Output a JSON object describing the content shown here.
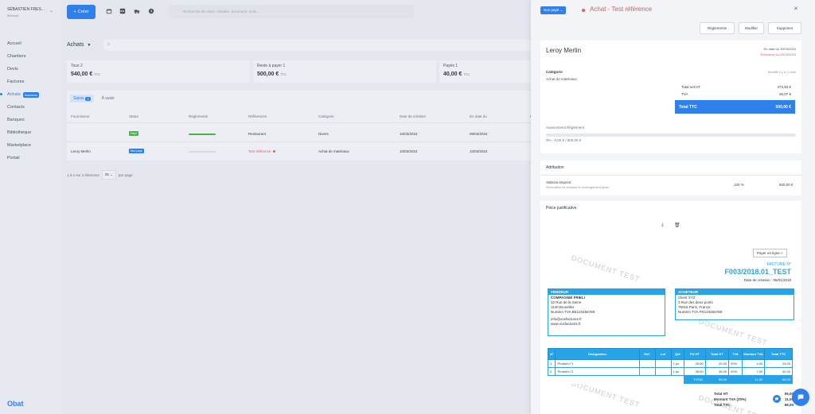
{
  "sidebar": {
    "user_name": "SÉBASTIEN FRES...",
    "user_sub": "Bichoutt",
    "items": [
      {
        "label": "Accueil"
      },
      {
        "label": "Chantiers"
      },
      {
        "label": "Devis"
      },
      {
        "label": "Factures"
      },
      {
        "label": "Achats",
        "badge": "Nouveau"
      },
      {
        "label": "Contacts"
      },
      {
        "label": "Banques"
      },
      {
        "label": "Bibliothèque"
      },
      {
        "label": "Marketplace"
      },
      {
        "label": "Portail"
      }
    ],
    "logo": "Obat"
  },
  "topbar": {
    "create_label": "Créer",
    "search_placeholder": "Recherche de client, chantier, document, texte..."
  },
  "main": {
    "title": "Achats",
    "stats": [
      {
        "label": "Tous",
        "count": "2",
        "value": "540,00 €",
        "unit": "TTC"
      },
      {
        "label": "Reste à payer",
        "count": "1",
        "value": "500,00 €",
        "unit": "TTC"
      },
      {
        "label": "Payés",
        "count": "1",
        "value": "40,00 €",
        "unit": "TTC"
      }
    ],
    "tabs": [
      {
        "label": "Saisis",
        "count": "2"
      },
      {
        "label": "À saisir"
      }
    ],
    "columns": [
      "Fournisseur",
      "Statut",
      "Règlements",
      "Références",
      "Catégorie",
      "Date de création",
      "En date du",
      "Éc"
    ],
    "rows": [
      {
        "supplier": "",
        "status": "Payé",
        "reference": "Restaurant",
        "category": "Divers",
        "created": "10/03/2024",
        "date": "09/03/2024"
      },
      {
        "supplier": "Leroy Merlin",
        "status": "Non payé",
        "reference": "Test référence",
        "category": "Achat de matériaux",
        "created": "10/03/2024",
        "date": "10/03/2024"
      }
    ],
    "pagination": "1 à 2 sur 2 éléments",
    "per_page": "25",
    "per_page_label": "par page"
  },
  "panel": {
    "status": "Non payé",
    "title": "Achat - Test référence",
    "actions": [
      "Règlements",
      "Modifier",
      "Supprimer"
    ],
    "supplier": "Leroy Merlin",
    "date_line": "En date du 10/03/2024",
    "due_line": "Échéance au 25/03/2024",
    "category_label": "Catégorie",
    "category_value": "Achat de matériaux",
    "modified": "Modifié il y a 1 mois",
    "total_ht_label": "Total net HT",
    "total_ht": "473,93 €",
    "tva_label": "TVA",
    "tva": "26,07 €",
    "total_ttc_label": "Total TTC",
    "total_ttc": "500,00 €",
    "progress_label": "Avancement Règlement",
    "progress_text": "0% - 0,00 € / 500,00 €",
    "progress_fraction": 0,
    "attribution_title": "Attribution",
    "attribution_name": "Sabrina Dupont",
    "attribution_desc": "Rénovation de terrasse et aménagement jardin",
    "attribution_pct": "100 %",
    "attribution_amount": "500,00 €",
    "piece_title": "Pièce justificative",
    "pay_online": "Payer en ligne »",
    "watermark": "DOCUMENT TEST",
    "invoice": {
      "label": "FACTURE N°",
      "number": "F003/2018.01_TEST",
      "date": "Date de création : 08/01/2018",
      "seller_head": "VENDEUR",
      "seller": [
        "COMPAGNIE FRIELI",
        "32 Rue de la Seine",
        "1140 Bruxelles",
        "Numéro TVA BE123456789",
        "",
        "info@vosfactures.fr",
        "www.vosfactures.fr"
      ],
      "buyer_head": "ACHETEUR",
      "buyer": [
        "Client XYZ",
        "3 Rue des deux ponts",
        "75016 Paris, France",
        "Numéro TVA FR123456789"
      ],
      "columns": [
        "N°",
        "Désignation",
        "Réf.",
        "Lot",
        "Qté",
        "PU HT",
        "Total HT",
        "TVA",
        "Montant TVA",
        "Total TTC"
      ],
      "rows": [
        [
          "1",
          "Produit n°1",
          "",
          "",
          "1 pc.",
          "20,00",
          "20,00",
          "20%",
          "4,00",
          "24,00"
        ],
        [
          "2",
          "Produit n°2",
          "",
          "",
          "1 pc.",
          "35,00",
          "35,00",
          "20%",
          "7,00",
          "42,00"
        ]
      ],
      "total_row": [
        "TOTAL",
        "55,00",
        "",
        "11,00",
        "66,00"
      ],
      "summary": [
        {
          "label": "Total HT",
          "value": "55,00"
        },
        {
          "label": "Montant TVA (20%)",
          "value": "11,00"
        },
        {
          "label": "Total TTC",
          "value": "66,00"
        }
      ]
    }
  },
  "colors": {
    "accent": "#2f80ed",
    "danger": "#e25a5a",
    "success": "#4caf50",
    "invoice_blue": "#29a3e8"
  }
}
